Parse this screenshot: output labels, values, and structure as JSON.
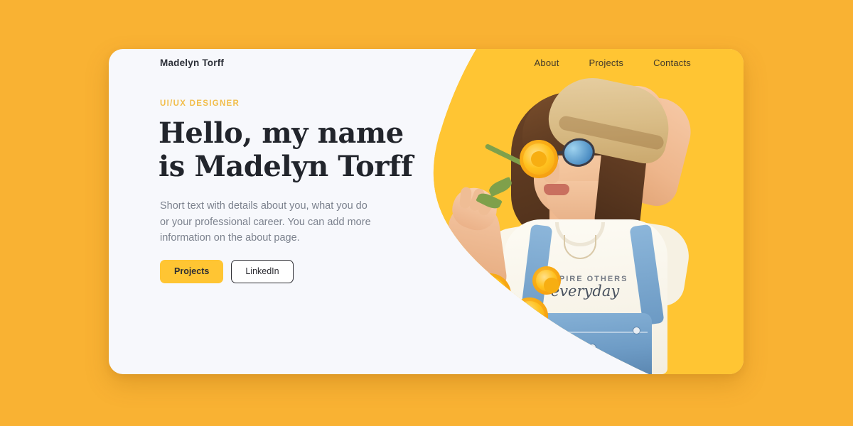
{
  "page": {
    "background_color": "#F9B233",
    "card_background": "#F7F8FC",
    "accent_yellow": "#FFC533",
    "eyebrow_color": "#F2BE4C",
    "heading_color": "#22252C",
    "body_text_color": "#7C828E"
  },
  "header": {
    "logo": "Madelyn Torff",
    "nav": [
      {
        "label": "About"
      },
      {
        "label": "Projects"
      },
      {
        "label": "Contacts"
      }
    ]
  },
  "hero": {
    "eyebrow": "UI/UX DESIGNER",
    "headline": "Hello,  my name\nis Madelyn Torff",
    "paragraph": "Short text with details about you, what you do or your professional career. You can add more information on the about page.",
    "buttons": [
      {
        "label": "Projects",
        "style": "primary"
      },
      {
        "label": "LinkedIn",
        "style": "outline"
      }
    ]
  },
  "photo": {
    "alt": "Smiling woman in a straw hat and blue mirrored sunglasses smelling a yellow marigold flower, wearing denim overalls",
    "shirt_text_line1": "INSPIRE OTHERS",
    "shirt_text_line2": "everyday"
  }
}
